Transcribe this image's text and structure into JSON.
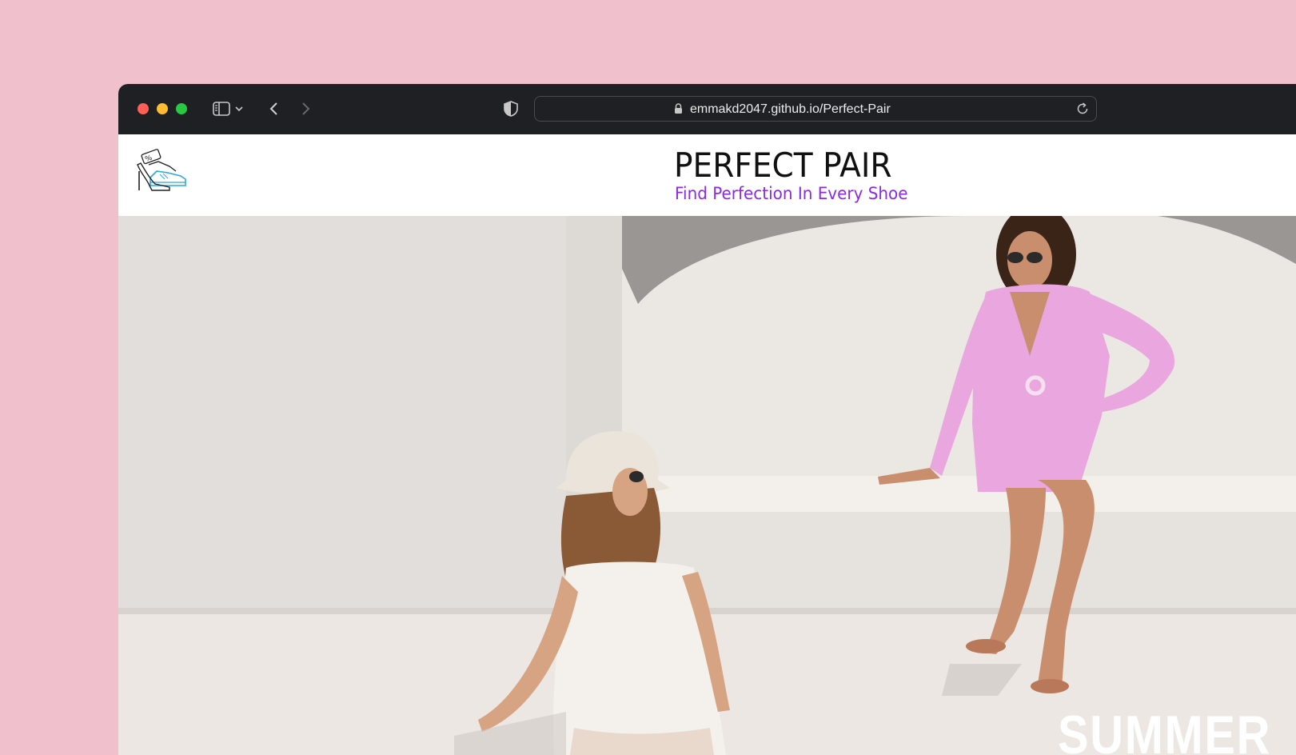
{
  "browser": {
    "url": "emmakd2047.github.io/Perfect-Pair",
    "icons": {
      "close": "red-traffic-light",
      "minimize": "yellow-traffic-light",
      "zoom": "green-traffic-light",
      "sidebar": "sidebar-icon",
      "chevron": "chevron-down-icon",
      "back": "back-arrow-icon",
      "forward": "forward-arrow-icon",
      "shield": "privacy-shield-icon",
      "lock": "lock-icon",
      "reload": "reload-icon"
    }
  },
  "site": {
    "title": "PERFECT PAIR",
    "tagline": "Find Perfection In Every Shoe",
    "logo_icon": "shoes-logo-icon",
    "tagline_color": "#8a2be2"
  },
  "hero": {
    "image": "two women in summer outfits sitting by a white wall",
    "overlay_text": "SUMMER"
  }
}
